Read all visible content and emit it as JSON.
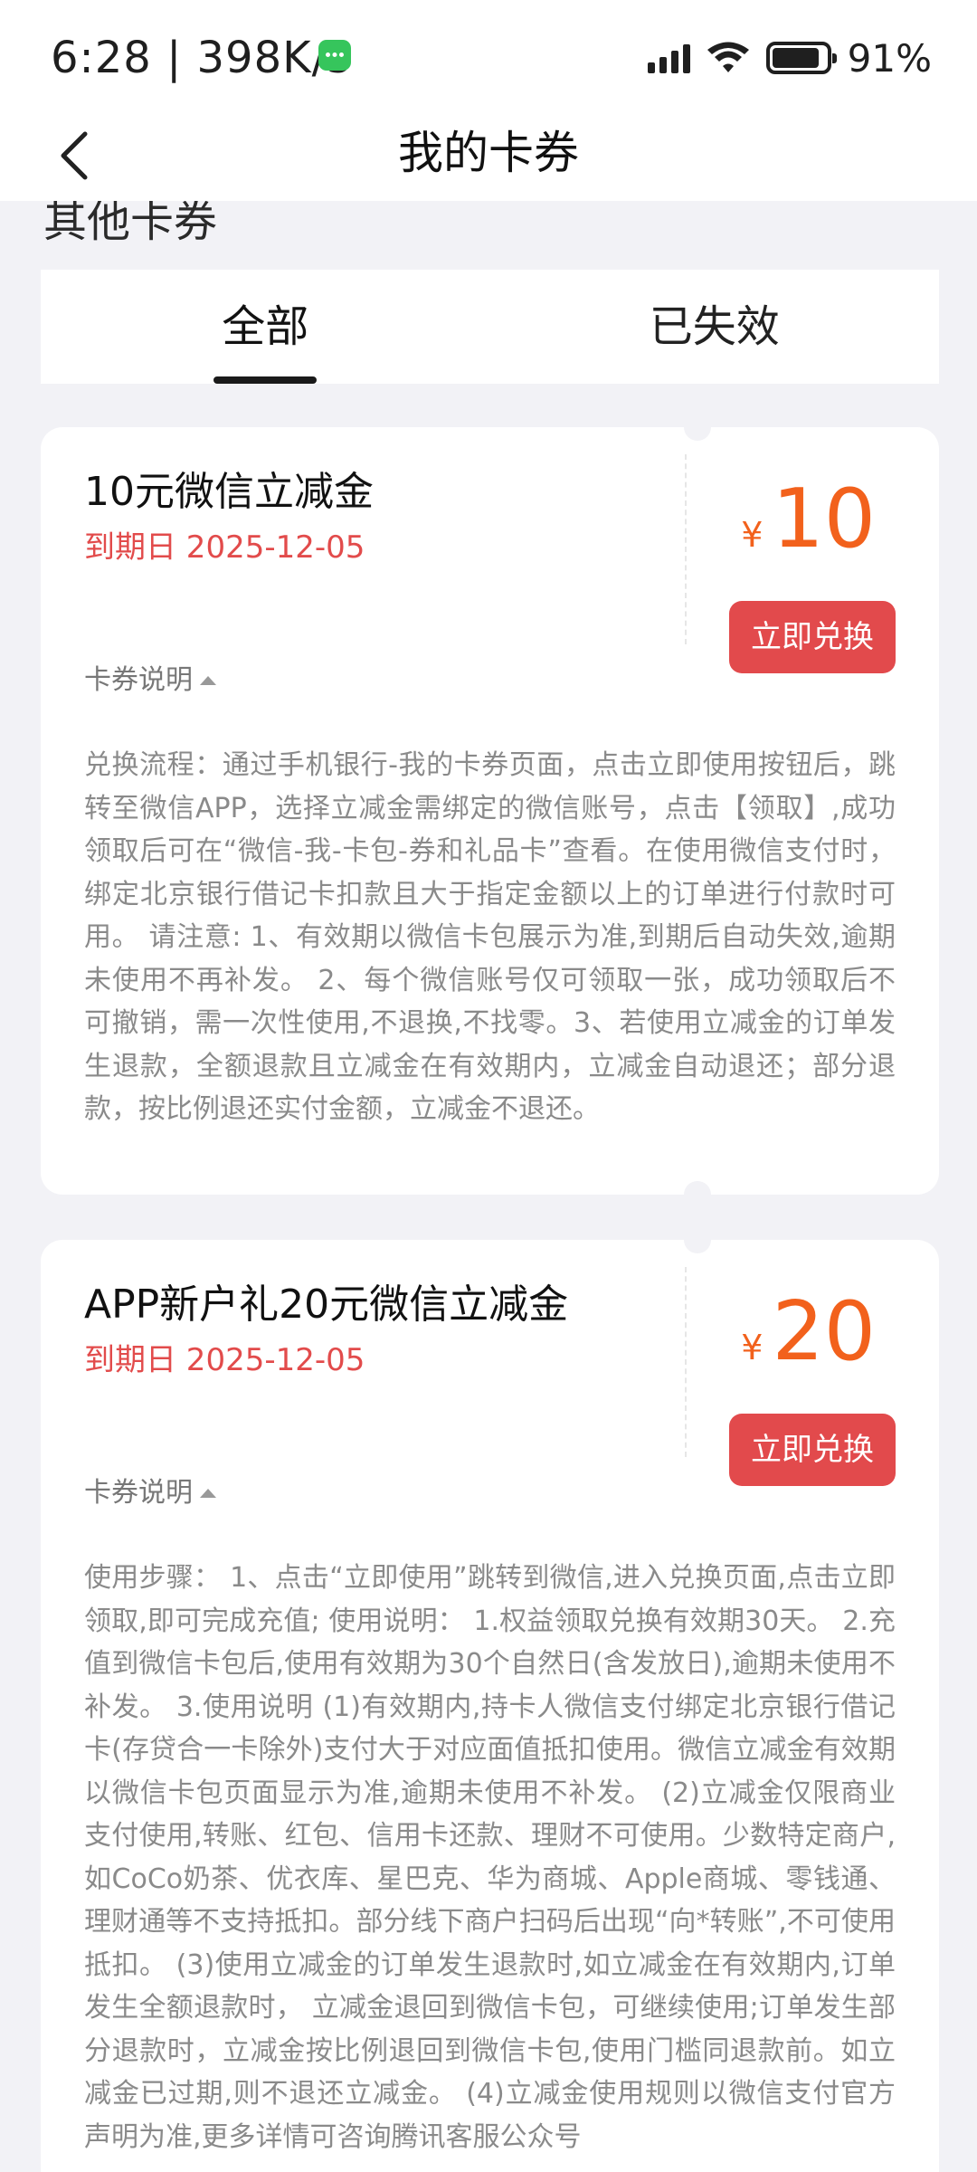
{
  "status_bar": {
    "time": "6:28",
    "net_speed": "| 398K/s",
    "battery": "91%"
  },
  "nav": {
    "title": "我的卡券",
    "back_icon": "chevron-left-icon"
  },
  "section_peek": "其他卡券",
  "tabs": [
    {
      "label": "全部",
      "active": true
    },
    {
      "label": "已失效",
      "active": false
    }
  ],
  "coupons": [
    {
      "title": "10元微信立减金",
      "expiry": "到期日 2025-12-05",
      "currency": "¥",
      "amount": "10",
      "redeem_label": "立即兑换",
      "desc_label": "卡券说明",
      "desc_text": "兑换流程：通过手机银行-我的卡券页面，点击立即使用按钮后，跳转至微信APP，选择立减金需绑定的微信账号，点击【领取】,成功领取后可在“微信-我-卡包-券和礼品卡”查看。在使用微信支付时，绑定北京银行借记卡扣款且大于指定金额以上的订单进行付款时可用。 请注意: 1、有效期以微信卡包展示为准,到期后自动失效,逾期未使用不再补发。 2、每个微信账号仅可领取一张，成功领取后不可撤销，需一次性使用,不退换,不找零。3、若使用立减金的订单发生退款，全额退款且立减金在有效期内，立减金自动退还；部分退款，按比例退还实付金额，立减金不退还。"
    },
    {
      "title": "APP新户礼20元微信立减金",
      "expiry": "到期日 2025-12-05",
      "currency": "¥",
      "amount": "20",
      "redeem_label": "立即兑换",
      "desc_label": "卡券说明",
      "desc_text": "使用步骤： 1、点击“立即使用”跳转到微信,进入兑换页面,点击立即领取,即可完成充值; 使用说明： 1.权益领取兑换有效期30天。 2.充值到微信卡包后,使用有效期为30个自然日(含发放日),逾期未使用不补发。 3.使用说明 (1)有效期内,持卡人微信支付绑定北京银行借记卡(存贷合一卡除外)支付大于对应面值抵扣使用。微信立减金有效期以微信卡包页面显示为准,逾期未使用不补发。 (2)立减金仅限商业支付使用,转账、红包、信用卡还款、理财不可使用。少数特定商户,如CoCo奶茶、优衣库、星巴克、华为商城、Apple商城、零钱通、理财通等不支持抵扣。部分线下商户扫码后出现“向*转账”,不可使用抵扣。 (3)使用立减金的订单发生退款时,如立减金在有效期内,订单发生全额退款时， 立减金退回到微信卡包，可继续使用;订单发生部分退款时，立减金按比例退回到微信卡包,使用门槛同退款前。如立减金已过期,则不退还立减金。 (4)立减金使用规则以微信支付官方声明为准,更多详情可咨询腾讯客服公众号"
    }
  ]
}
